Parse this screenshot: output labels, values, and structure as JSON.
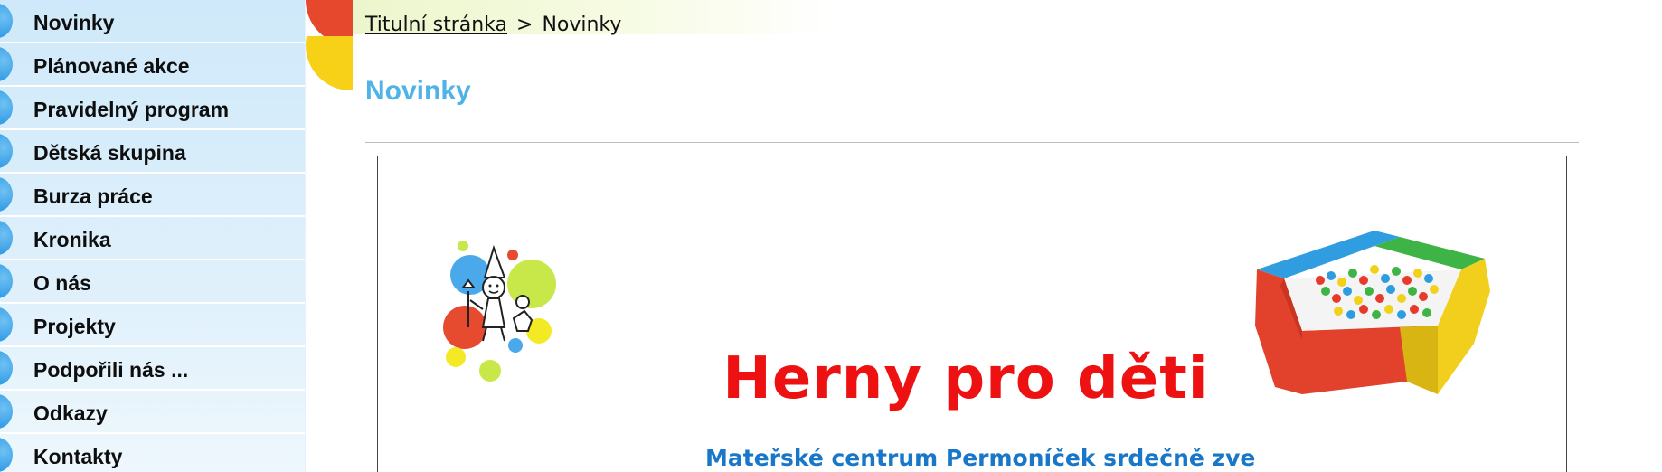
{
  "sidebar": {
    "items": [
      {
        "label": "Novinky"
      },
      {
        "label": "Plánované akce"
      },
      {
        "label": "Pravidelný program"
      },
      {
        "label": "Dětská skupina"
      },
      {
        "label": "Burza práce"
      },
      {
        "label": "Kronika"
      },
      {
        "label": "O nás"
      },
      {
        "label": "Projekty"
      },
      {
        "label": "Podpořili nás ..."
      },
      {
        "label": "Odkazy"
      },
      {
        "label": "Kontakty"
      }
    ]
  },
  "breadcrumb": {
    "home": "Titulní stránka",
    "separator": ">",
    "current": "Novinky"
  },
  "page": {
    "title": "Novinky"
  },
  "content": {
    "headline": "Herny pro děti",
    "subline": "Mateřské centrum Permoníček srdečně zve"
  },
  "colors": {
    "title_blue": "#4fb3e8",
    "headline_red": "#ee1111",
    "subline_blue": "#1877c8",
    "bullet_blue": "#2f9ae5"
  }
}
